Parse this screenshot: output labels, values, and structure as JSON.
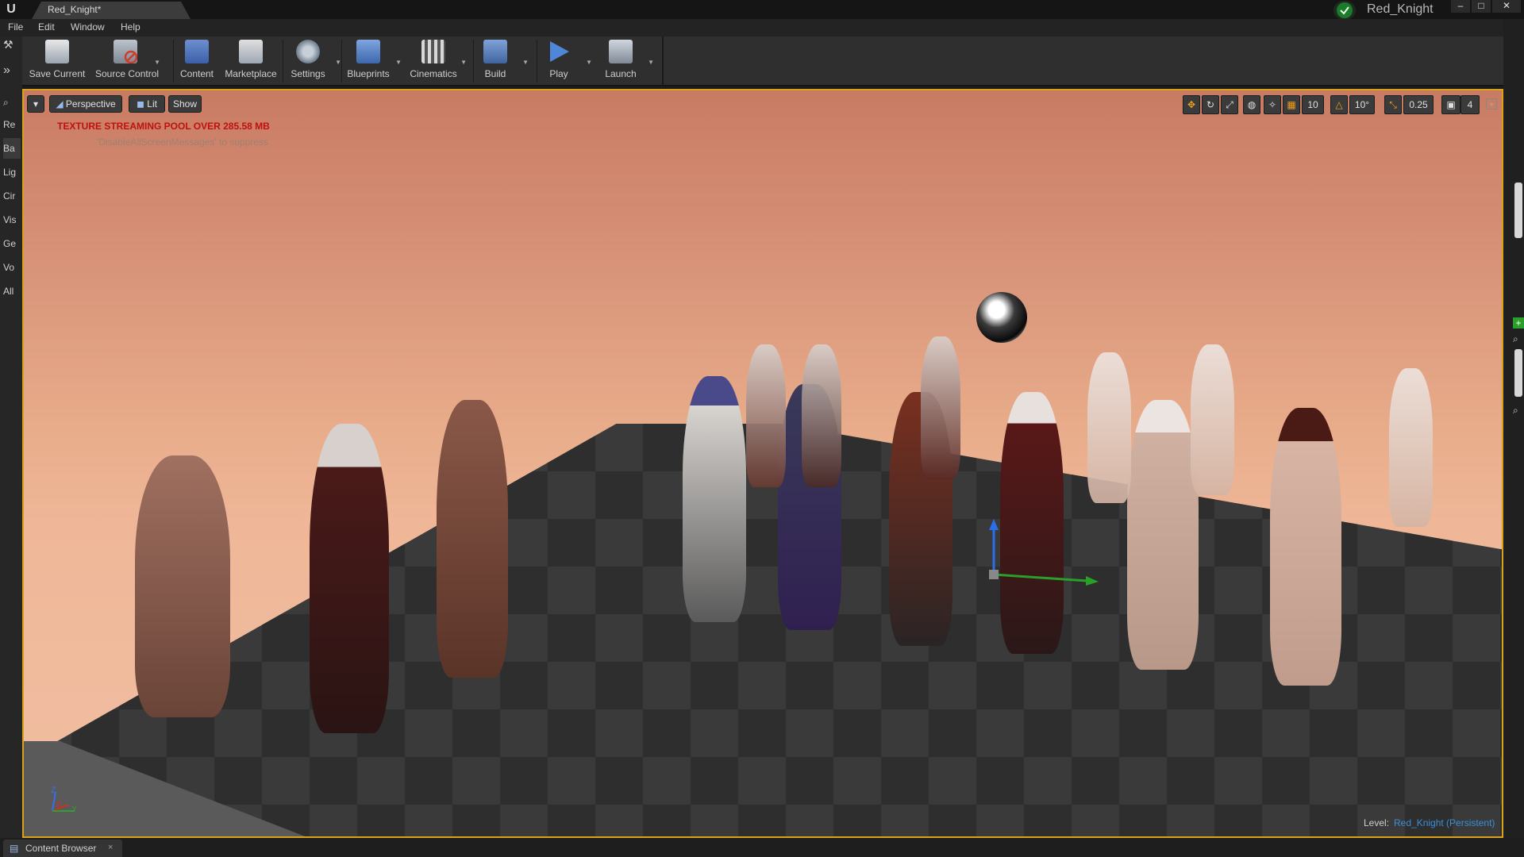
{
  "window": {
    "tab_title": "Red_Knight*",
    "project_name": "Red_Knight",
    "minimize": "–",
    "maximize": "□",
    "close": "✕"
  },
  "menu": [
    "File",
    "Edit",
    "Window",
    "Help"
  ],
  "toolbar": [
    {
      "label": "Save Current",
      "icon": "save-icon"
    },
    {
      "label": "Source Control",
      "icon": "source-control-icon"
    },
    {
      "label": "Content",
      "icon": "content-icon"
    },
    {
      "label": "Marketplace",
      "icon": "marketplace-icon"
    },
    {
      "label": "Settings",
      "icon": "settings-icon"
    },
    {
      "label": "Blueprints",
      "icon": "blueprints-icon"
    },
    {
      "label": "Cinematics",
      "icon": "cinematics-icon"
    },
    {
      "label": "Build",
      "icon": "build-icon"
    },
    {
      "label": "Play",
      "icon": "play-icon"
    },
    {
      "label": "Launch",
      "icon": "launch-icon"
    }
  ],
  "mode_tabs": [
    "Re",
    "Ba",
    "Lig",
    "Cir",
    "Vis",
    "Ge",
    "Vo",
    "All"
  ],
  "viewport": {
    "perspective": "Perspective",
    "lit": "Lit",
    "show": "Show",
    "warning": "TEXTURE STREAMING POOL OVER 285.58 MB",
    "suppress_hint": "'DisableAllScreenMessages' to suppress",
    "grid_snap": "10",
    "rotation_snap": "10°",
    "scale_snap": "0.25",
    "camera_speed": "4",
    "level_label": "Level:",
    "level_name": "Red_Knight (Persistent)",
    "axis_z": "Z",
    "axis_x": "X",
    "axis_y": "Y"
  },
  "bottom": {
    "content_browser": "Content Browser",
    "close": "×"
  },
  "colors": {
    "accent_border": "#d9a21a",
    "warning": "#c01010",
    "level_link": "#3a8fd6"
  }
}
